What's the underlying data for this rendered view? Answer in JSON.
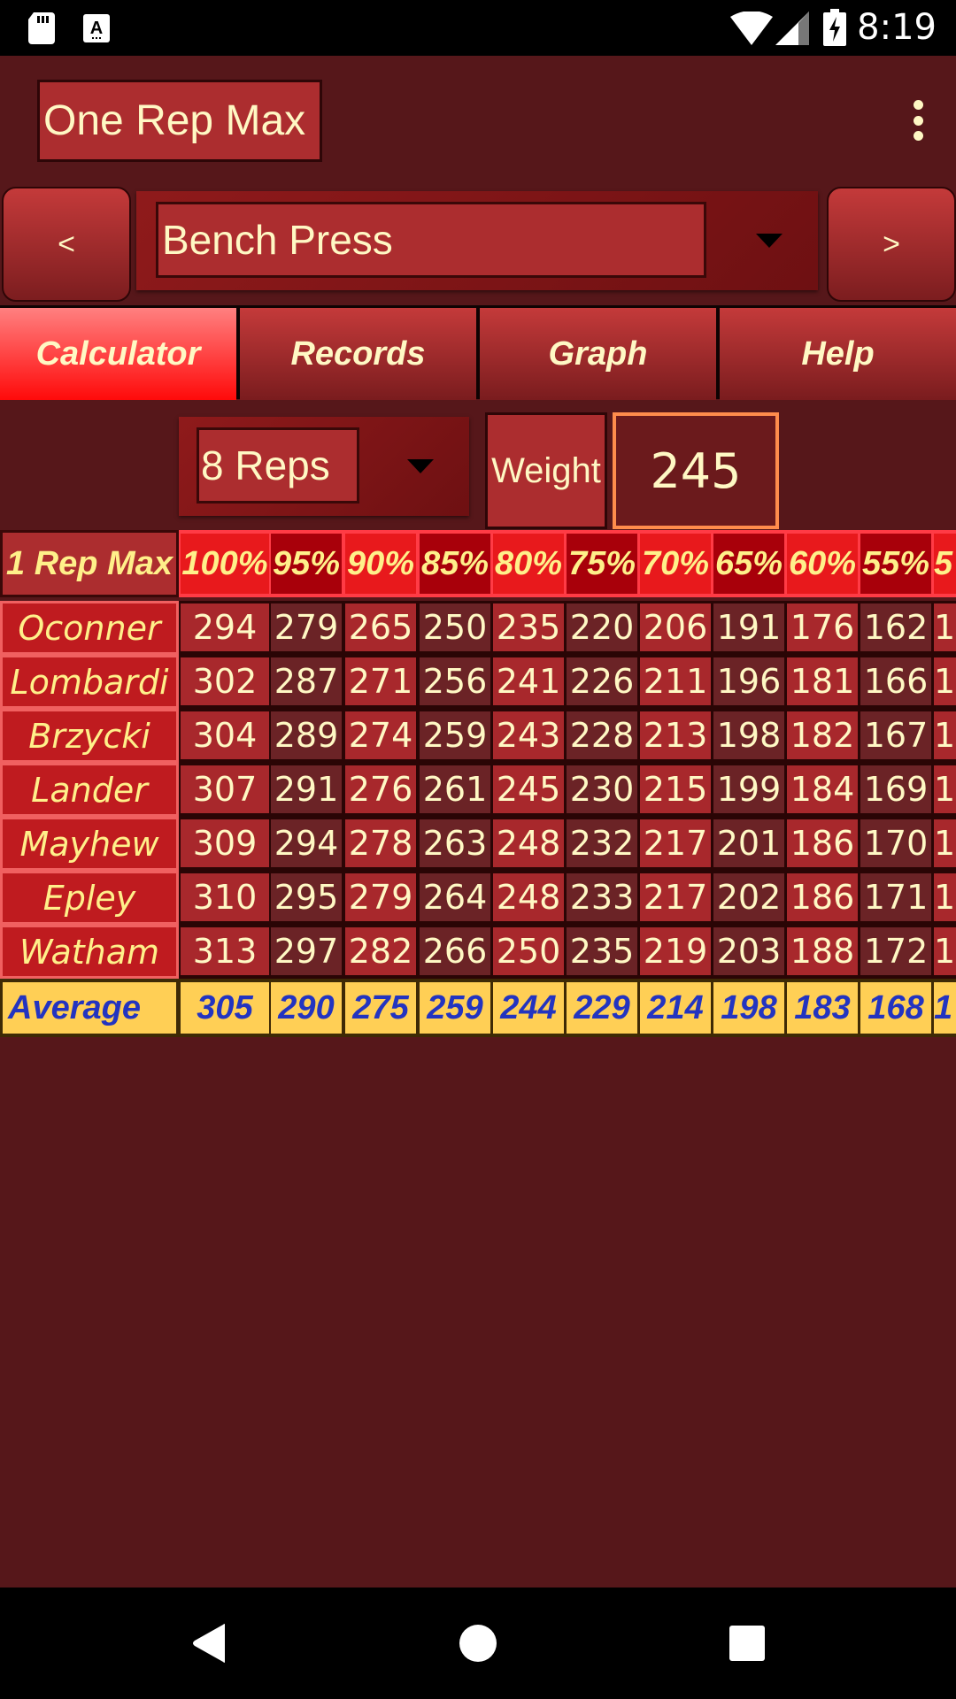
{
  "status_bar": {
    "time": "8:19",
    "icons": [
      "sd-card-icon",
      "font-a-icon",
      "wifi-icon",
      "signal-icon",
      "battery-charging-icon"
    ]
  },
  "app_bar": {
    "title": "One Rep Max",
    "menu_icon": "overflow-menu-icon"
  },
  "exercise_selector": {
    "prev_label": "<",
    "next_label": ">",
    "selected": "Bench Press"
  },
  "tabs": [
    {
      "label": "Calculator",
      "active": true
    },
    {
      "label": "Records",
      "active": false
    },
    {
      "label": "Graph",
      "active": false
    },
    {
      "label": "Help",
      "active": false
    }
  ],
  "inputs": {
    "reps_selected": "8 Reps",
    "weight_label": "Weight",
    "weight_value": "245"
  },
  "table": {
    "corner_label": "1 Rep Max",
    "columns": [
      "100%",
      "95%",
      "90%",
      "85%",
      "80%",
      "75%",
      "70%",
      "65%",
      "60%",
      "55%",
      "5"
    ],
    "rows": [
      {
        "name": "Oconner",
        "values": [
          "294",
          "279",
          "265",
          "250",
          "235",
          "220",
          "206",
          "191",
          "176",
          "162",
          "1"
        ]
      },
      {
        "name": "Lombardi",
        "values": [
          "302",
          "287",
          "271",
          "256",
          "241",
          "226",
          "211",
          "196",
          "181",
          "166",
          "1"
        ]
      },
      {
        "name": "Brzycki",
        "values": [
          "304",
          "289",
          "274",
          "259",
          "243",
          "228",
          "213",
          "198",
          "182",
          "167",
          "1"
        ]
      },
      {
        "name": "Lander",
        "values": [
          "307",
          "291",
          "276",
          "261",
          "245",
          "230",
          "215",
          "199",
          "184",
          "169",
          "1"
        ]
      },
      {
        "name": "Mayhew",
        "values": [
          "309",
          "294",
          "278",
          "263",
          "248",
          "232",
          "217",
          "201",
          "186",
          "170",
          "1"
        ]
      },
      {
        "name": "Epley",
        "values": [
          "310",
          "295",
          "279",
          "264",
          "248",
          "233",
          "217",
          "202",
          "186",
          "171",
          "1"
        ]
      },
      {
        "name": "Watham",
        "values": [
          "313",
          "297",
          "282",
          "266",
          "250",
          "235",
          "219",
          "203",
          "188",
          "172",
          "1"
        ]
      }
    ],
    "average": {
      "name": "Average",
      "values": [
        "305",
        "290",
        "275",
        "259",
        "244",
        "229",
        "214",
        "198",
        "183",
        "168",
        "1"
      ]
    }
  },
  "colors": {
    "background": "#56171a",
    "accent_active_tab": "#ff0a0a",
    "text_cream": "#fff8c4",
    "average_bg": "#ffcf55",
    "average_text": "#2334c0",
    "weight_border": "#ff8c4c"
  },
  "nav_bar": {
    "buttons": [
      "back-icon",
      "home-icon",
      "recents-icon"
    ]
  }
}
